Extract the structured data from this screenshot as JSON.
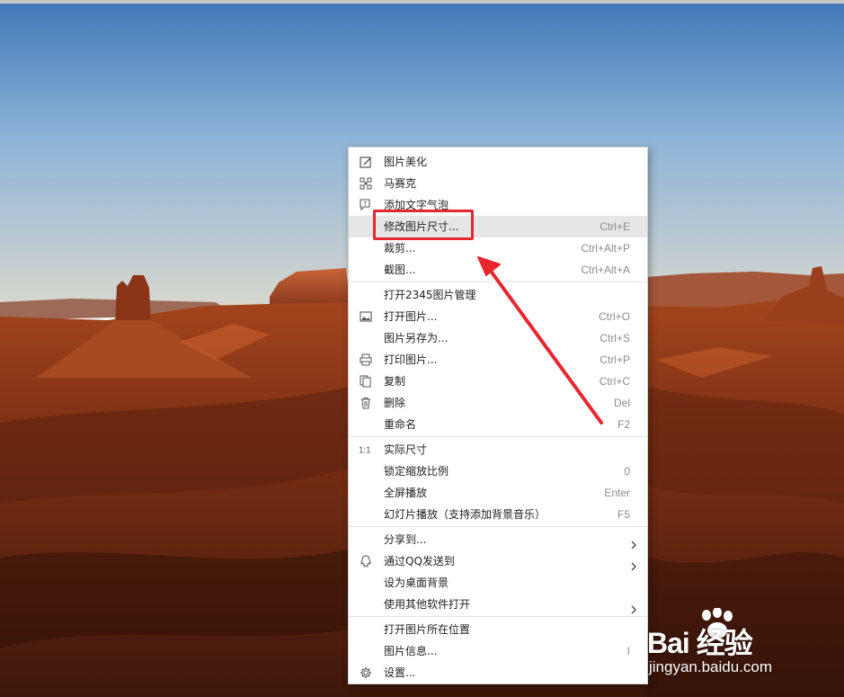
{
  "context_menu": {
    "sections": [
      [
        {
          "icon": "pencil-icon",
          "label": "图片美化",
          "shortcut": ""
        },
        {
          "icon": "mosaic-icon",
          "label": "马赛克",
          "shortcut": ""
        },
        {
          "icon": "text-bubble-icon",
          "label": "添加文字气泡",
          "shortcut": ""
        },
        {
          "icon": "",
          "label": "修改图片尺寸...",
          "shortcut": "Ctrl+E",
          "highlighted": true
        },
        {
          "icon": "",
          "label": "裁剪...",
          "shortcut": "Ctrl+Alt+P"
        },
        {
          "icon": "",
          "label": "截图...",
          "shortcut": "Ctrl+Alt+A"
        }
      ],
      [
        {
          "icon": "",
          "label": "打开2345图片管理",
          "shortcut": ""
        },
        {
          "icon": "image-icon",
          "label": "打开图片...",
          "shortcut": "Ctrl+O"
        },
        {
          "icon": "",
          "label": "图片另存为...",
          "shortcut": "Ctrl+S"
        },
        {
          "icon": "printer-icon",
          "label": "打印图片...",
          "shortcut": "Ctrl+P"
        },
        {
          "icon": "copy-icon",
          "label": "复制",
          "shortcut": "Ctrl+C"
        },
        {
          "icon": "trash-icon",
          "label": "删除",
          "shortcut": "Del"
        },
        {
          "icon": "",
          "label": "重命名",
          "shortcut": "F2"
        }
      ],
      [
        {
          "icon": "actual-size-icon",
          "label": "实际尺寸",
          "shortcut": ""
        },
        {
          "icon": "",
          "label": "锁定缩放比例",
          "shortcut": "0"
        },
        {
          "icon": "",
          "label": "全屏播放",
          "shortcut": "Enter"
        },
        {
          "icon": "",
          "label": "幻灯片播放（支持添加背景音乐）",
          "shortcut": "F5"
        }
      ],
      [
        {
          "icon": "",
          "label": "分享到...",
          "shortcut": "",
          "submenu": true
        },
        {
          "icon": "qq-icon",
          "label": "通过QQ发送到",
          "shortcut": "",
          "submenu": true
        },
        {
          "icon": "",
          "label": "设为桌面背景",
          "shortcut": ""
        },
        {
          "icon": "",
          "label": "使用其他软件打开",
          "shortcut": "",
          "submenu": true
        }
      ],
      [
        {
          "icon": "",
          "label": "打开图片所在位置",
          "shortcut": ""
        },
        {
          "icon": "",
          "label": "图片信息...",
          "shortcut": "I"
        },
        {
          "icon": "gear-icon",
          "label": "设置...",
          "shortcut": ""
        }
      ]
    ]
  },
  "annotation": {
    "color": "#e8262e"
  },
  "watermark": {
    "logo": "Bai  经验",
    "url": "jingyan.baidu.com"
  }
}
